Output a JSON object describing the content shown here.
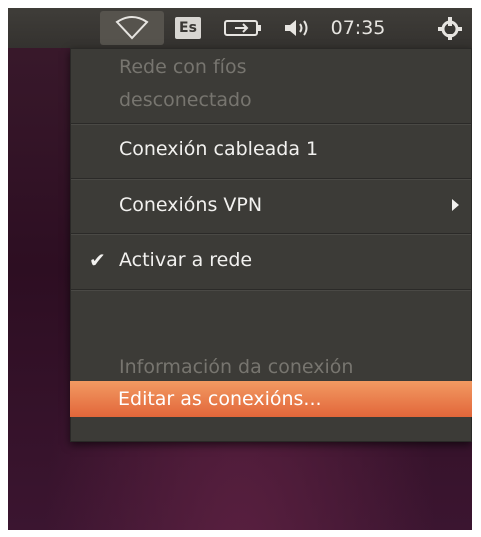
{
  "panel": {
    "keyboard_label": "Es",
    "clock": "07:35",
    "icons": {
      "network": "wifi-icon",
      "battery": "battery-icon",
      "sound": "volume-icon",
      "session": "power-icon"
    }
  },
  "menu": {
    "header_line1": "Rede con fíos",
    "header_line2": "desconectado",
    "wired_connection": "Conexión cableada 1",
    "vpn": "Conexións VPN",
    "enable_network": "Activar a rede",
    "connection_info": "Información da conexión",
    "edit_connections": "Editar as conexións..."
  },
  "colors": {
    "highlight": "#e2663a",
    "panel_bg": "#3c3b37",
    "wallpaper": "#2d0e22"
  }
}
